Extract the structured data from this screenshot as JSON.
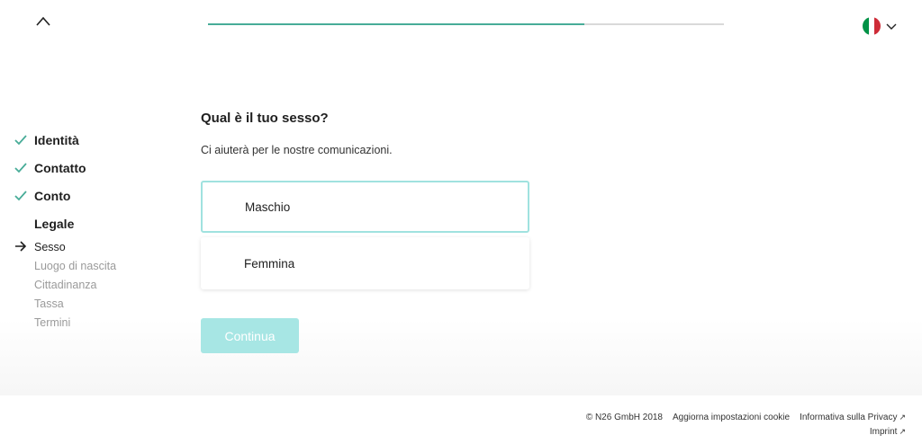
{
  "header": {
    "progress": 0.73,
    "language": "it",
    "colors": {
      "progress": "#48ac98",
      "track": "#d9d9d9"
    }
  },
  "steps": [
    {
      "label": "Identità",
      "done": true
    },
    {
      "label": "Contatto",
      "done": true
    },
    {
      "label": "Conto",
      "done": true
    },
    {
      "label": "Legale",
      "done": false
    }
  ],
  "substeps": [
    {
      "label": "Sesso",
      "active": true
    },
    {
      "label": "Luogo di nascita",
      "active": false
    },
    {
      "label": "Cittadinanza",
      "active": false
    },
    {
      "label": "Tassa",
      "active": false
    },
    {
      "label": "Termini",
      "active": false
    }
  ],
  "form": {
    "question": "Qual è il tuo sesso?",
    "subtitle": "Ci aiuterà per le nostre comunicazioni.",
    "options": [
      {
        "label": "Maschio",
        "selected": true
      },
      {
        "label": "Femmina",
        "selected": false
      }
    ],
    "continue_label": "Continua"
  },
  "footer": {
    "copyright": "© N26 GmbH 2018",
    "cookie_link": "Aggiorna impostazioni cookie",
    "privacy_link": "Informativa sulla Privacy",
    "imprint_link": "Imprint"
  }
}
